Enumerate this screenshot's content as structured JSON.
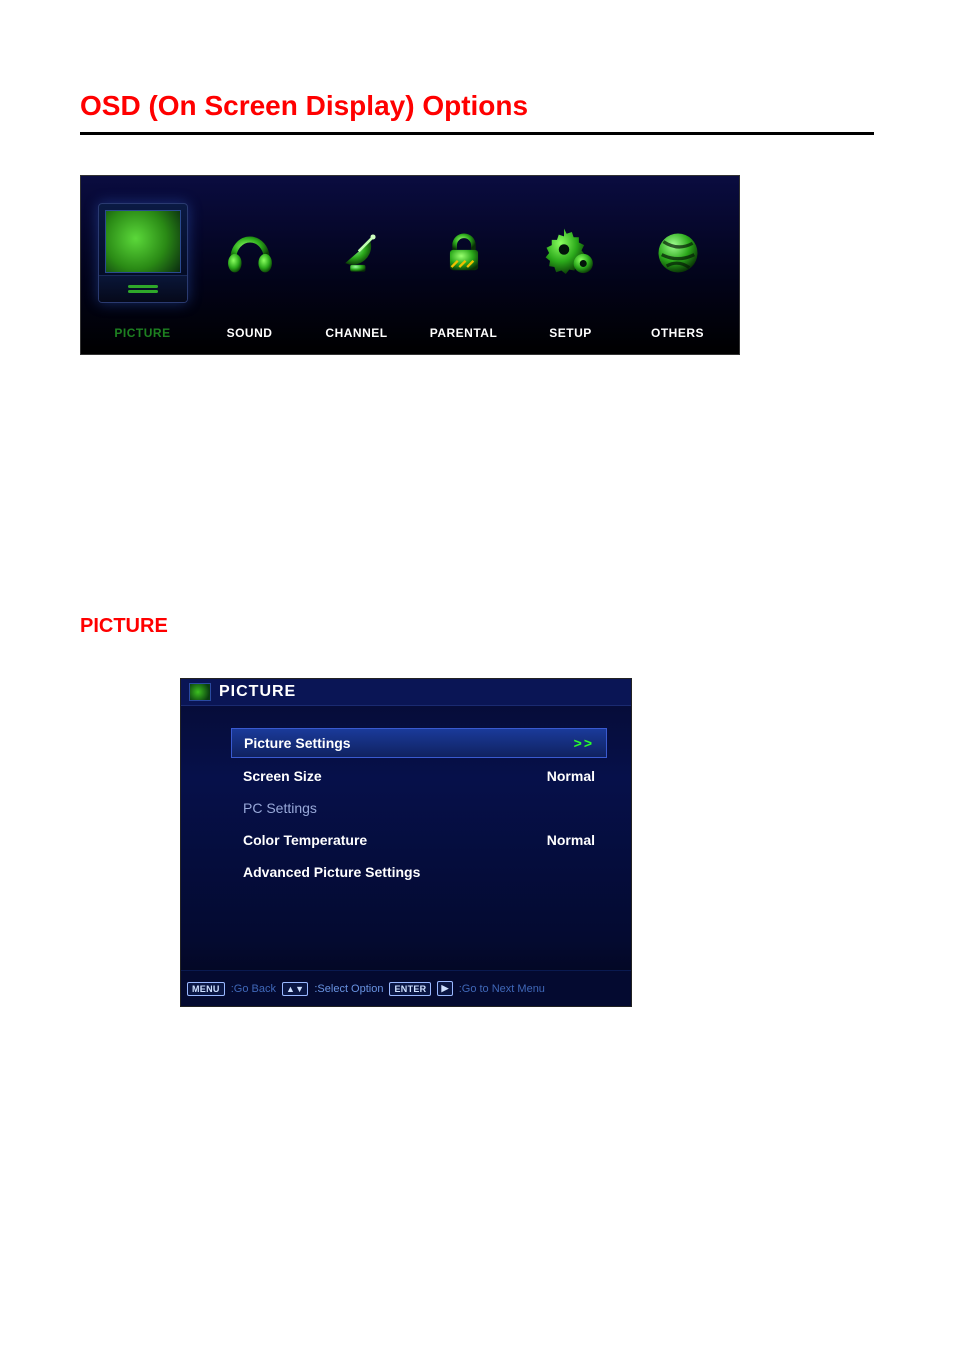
{
  "page": {
    "title": "OSD (On Screen Display) Options",
    "section_title": "PICTURE"
  },
  "osd_tabs": [
    {
      "id": "picture",
      "label": "PICTURE",
      "selected": true
    },
    {
      "id": "sound",
      "label": "SOUND",
      "selected": false
    },
    {
      "id": "channel",
      "label": "CHANNEL",
      "selected": false
    },
    {
      "id": "parental",
      "label": "PARENTAL",
      "selected": false
    },
    {
      "id": "setup",
      "label": "SETUP",
      "selected": false
    },
    {
      "id": "others",
      "label": "OTHERS",
      "selected": false
    }
  ],
  "picture_menu": {
    "header": "PICTURE",
    "rows": [
      {
        "label": "Picture Settings",
        "value": ">>",
        "highlight": true,
        "dim": false
      },
      {
        "label": "Screen Size",
        "value": "Normal",
        "highlight": false,
        "dim": false
      },
      {
        "label": "PC Settings",
        "value": "",
        "highlight": false,
        "dim": true
      },
      {
        "label": "Color Temperature",
        "value": "Normal",
        "highlight": false,
        "dim": false
      },
      {
        "label": "Advanced Picture Settings",
        "value": "",
        "highlight": false,
        "dim": false
      }
    ],
    "footer": {
      "menu_key": "MENU",
      "menu_hint": ":Go Back",
      "updown_key": "▲▼",
      "updown_hint": ":Select Option",
      "enter_key": "ENTER",
      "right_key": "▶",
      "right_hint": ":Go to Next Menu"
    }
  }
}
